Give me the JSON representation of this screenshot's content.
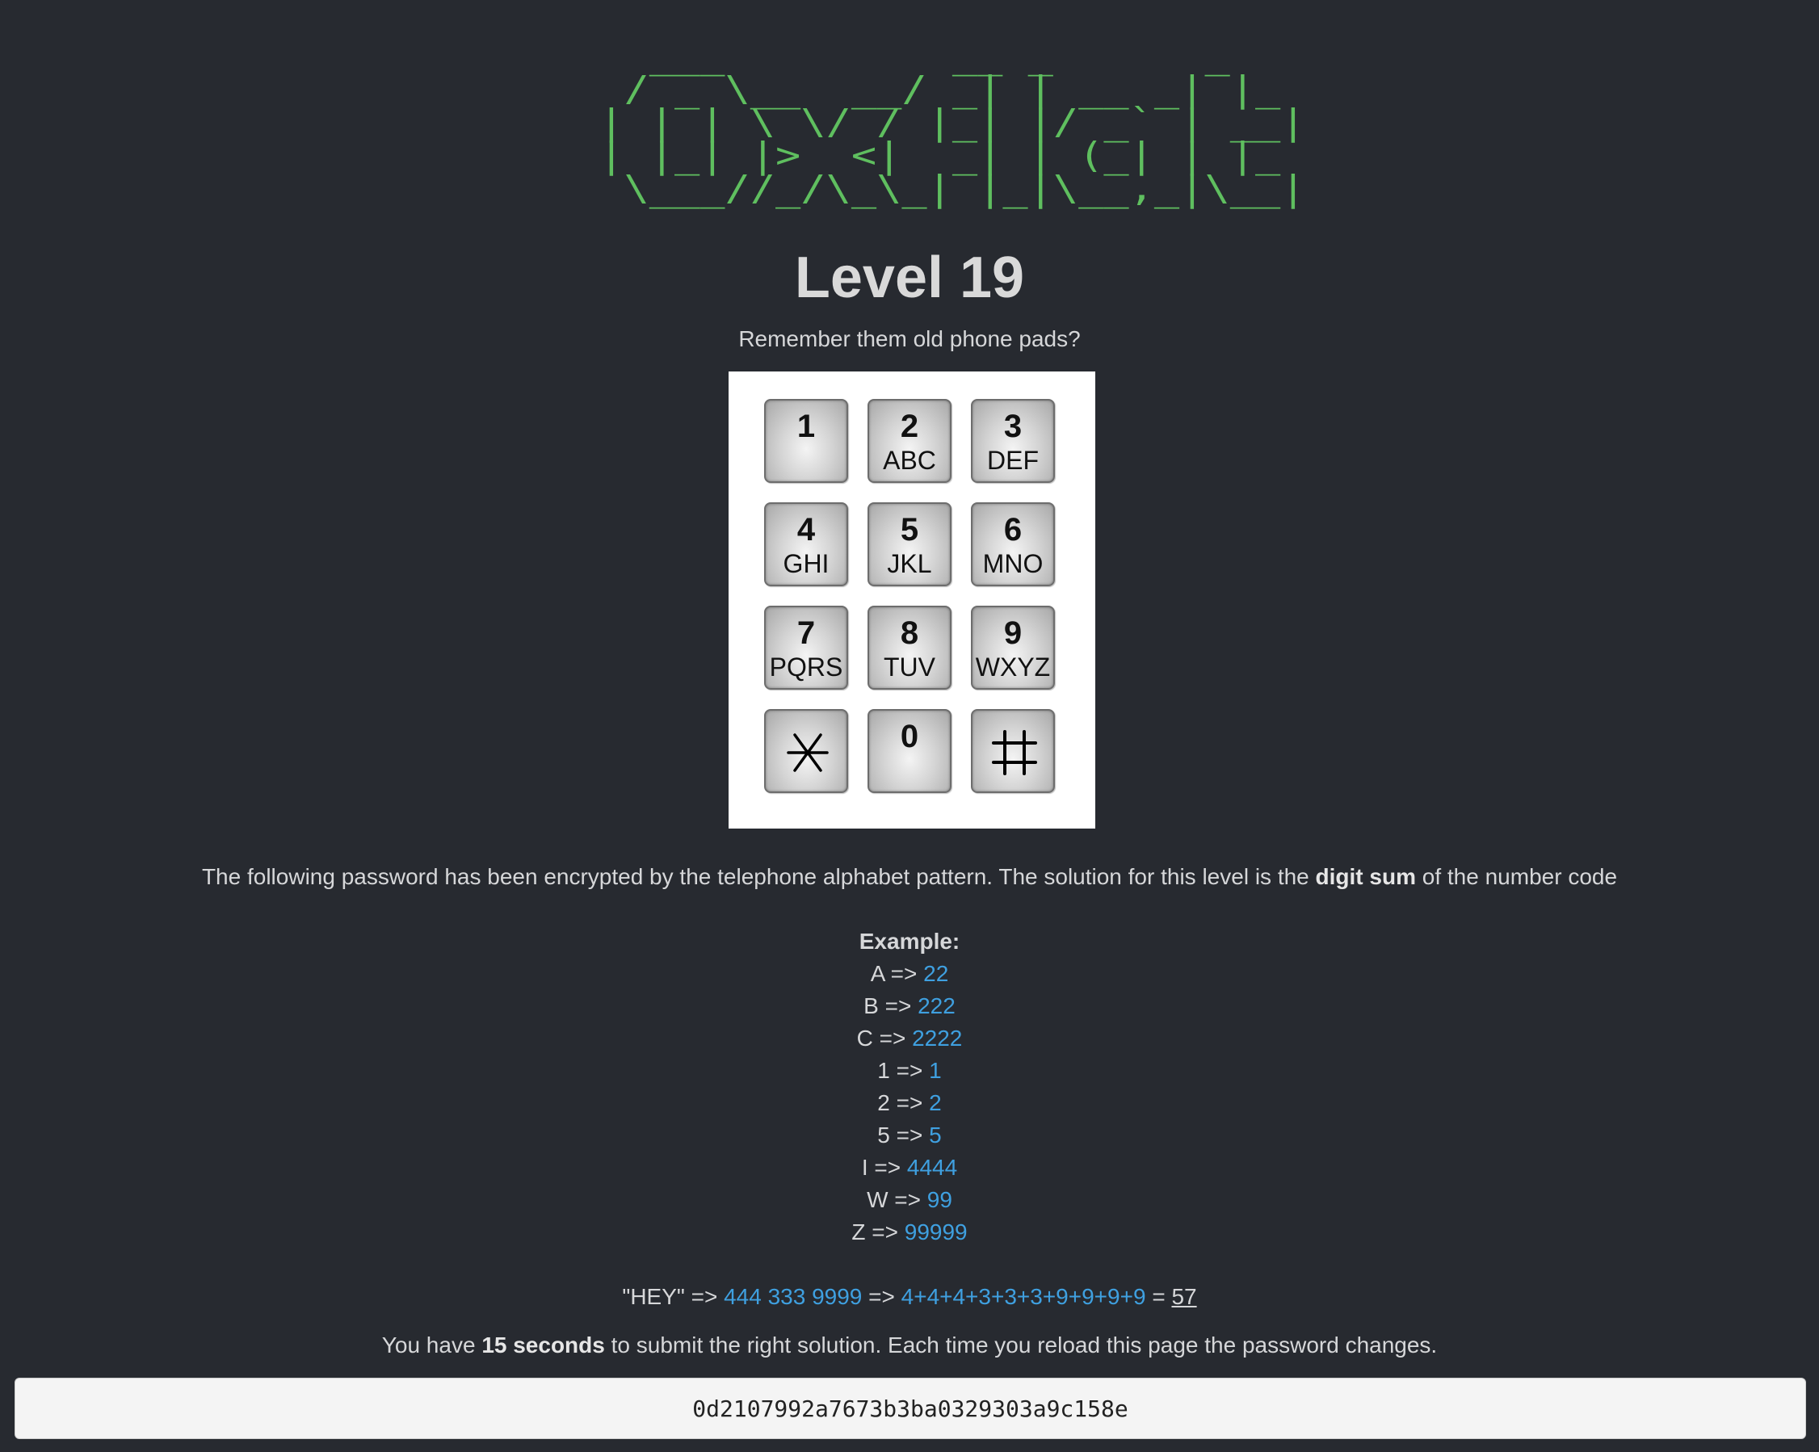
{
  "logo_ascii": "  ___         __ _      _   \n / _ \\__  __/ _| | __ _| |_ \n| | | \\ \\/ / |_| |/ _` | __|\n| |_| |>  <|  _| | (_| | |_ \n \\___//_/\\_\\_| |_|\\__,_|\\__|",
  "level_title": "Level 19",
  "subtitle": "Remember them old phone pads?",
  "keypad": {
    "keys": [
      {
        "digit": "1",
        "letters": ""
      },
      {
        "digit": "2",
        "letters": "ABC"
      },
      {
        "digit": "3",
        "letters": "DEF"
      },
      {
        "digit": "4",
        "letters": "GHI"
      },
      {
        "digit": "5",
        "letters": "JKL"
      },
      {
        "digit": "6",
        "letters": "MNO"
      },
      {
        "digit": "7",
        "letters": "PQRS"
      },
      {
        "digit": "8",
        "letters": "TUV"
      },
      {
        "digit": "9",
        "letters": "WXYZ"
      },
      {
        "digit": "",
        "letters": "",
        "icon": "asterisk-icon"
      },
      {
        "digit": "0",
        "letters": ""
      },
      {
        "digit": "",
        "letters": "",
        "icon": "hash-icon"
      }
    ]
  },
  "description": {
    "before": "The following password has been encrypted by the telephone alphabet pattern. The solution for this level is the ",
    "bold": "digit sum",
    "after": " of the number code"
  },
  "example": {
    "title": "Example:",
    "rows": [
      {
        "input": "A",
        "arrow": "=>",
        "output": "22"
      },
      {
        "input": "B",
        "arrow": "=>",
        "output": "222"
      },
      {
        "input": "C",
        "arrow": "=>",
        "output": "2222"
      },
      {
        "input": "1",
        "arrow": "=>",
        "output": "1"
      },
      {
        "input": "2",
        "arrow": "=>",
        "output": "2"
      },
      {
        "input": "5",
        "arrow": "=>",
        "output": "5"
      },
      {
        "input": "I",
        "arrow": "=>",
        "output": "4444"
      },
      {
        "input": "W",
        "arrow": "=>",
        "output": "99"
      },
      {
        "input": "Z",
        "arrow": "=>",
        "output": "99999"
      }
    ]
  },
  "hey_example": {
    "word": "\"HEY\"",
    "arrow1": "=>",
    "codes": "444 333 9999",
    "arrow2": "=>",
    "sum_expr": "4+4+4+3+3+3+9+9+9+9",
    "equals": "=",
    "result": "57"
  },
  "timer": {
    "before": "You have ",
    "bold": "15 seconds",
    "after": " to submit the right solution. Each time you reload this page the password changes."
  },
  "password_input": {
    "value": "0d2107992a7673b3ba0329303a9c158e"
  },
  "colors": {
    "background": "#272a30",
    "logo_green": "#5fbf5f",
    "link_blue": "#3fa0e0"
  }
}
